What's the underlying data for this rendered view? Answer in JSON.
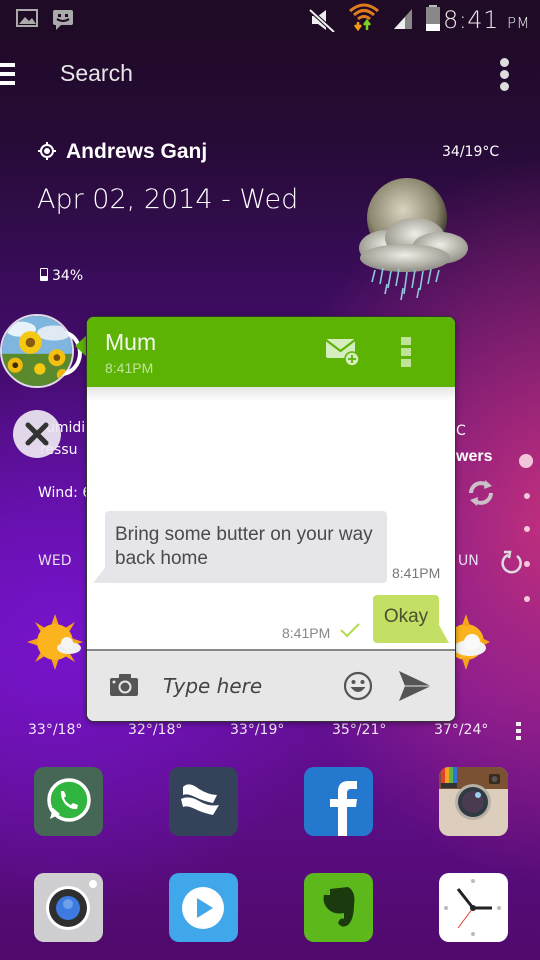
{
  "status_bar": {
    "left_icons": [
      "gallery-notification-icon",
      "messenger-notification-icon"
    ],
    "right_icons": [
      "mute-icon",
      "wifi-data-icon",
      "signal-icon",
      "battery-icon"
    ],
    "time": "8:41",
    "ampm": "PM"
  },
  "search_bar": {
    "label": "Search",
    "menu_icon": "hamburger-menu-icon",
    "overflow_icon": "more-vertical-icon"
  },
  "weather": {
    "location": "Andrews Ganj",
    "hi_lo": "34/19°C",
    "date": "Apr 02, 2014 - Wed",
    "battery": "34%",
    "condition_icon": "moon-cloud-rain-icon",
    "partial_labels": {
      "humidity": "umidi",
      "pressure": "ressu",
      "wind": "Wind: 6",
      "unit_fragment": "C",
      "condition_fragment": "wers",
      "day_right_fragment": "UN"
    },
    "forecast": {
      "days_visible": [
        "WED"
      ],
      "temps": [
        "33°/18°",
        "32°/18°",
        "33°/19°",
        "35°/21°",
        "37°/24°"
      ]
    }
  },
  "chat_popup": {
    "contact_name": "Mum",
    "header_time": "8:41PM",
    "messages": [
      {
        "direction": "incoming",
        "text": "Bring some butter on your way back home",
        "time": "8:41PM"
      },
      {
        "direction": "outgoing",
        "text": "Okay",
        "time": "8:41PM",
        "status": "delivered"
      }
    ],
    "input_placeholder": "Type here",
    "colors": {
      "header": "#5cb304",
      "outgoing_bubble": "#c4e064",
      "incoming_bubble": "#e6e5ea"
    }
  },
  "apps": {
    "row1": [
      "WhatsApp",
      "Bacon",
      "Facebook",
      "Instagram"
    ],
    "row2": [
      "Camera",
      "Video Player",
      "Evernote",
      "Clock"
    ]
  }
}
